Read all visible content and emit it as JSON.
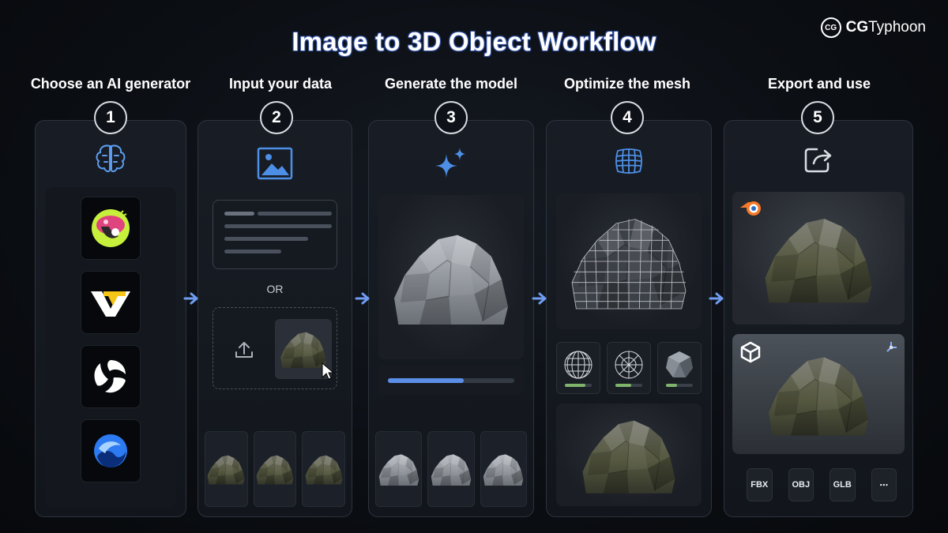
{
  "title": "Image to 3D Object Workflow",
  "brand": {
    "logo": "CG",
    "name_bold": "CG",
    "name_rest": "Typhoon"
  },
  "steps": [
    {
      "number": "1",
      "title": "Choose an AI generator"
    },
    {
      "number": "2",
      "title": "Input your data"
    },
    {
      "number": "3",
      "title": "Generate the model"
    },
    {
      "number": "4",
      "title": "Optimize the mesh"
    },
    {
      "number": "5",
      "title": "Export and use"
    }
  ],
  "col1": {
    "icon": "brain-icon",
    "generators": [
      "mushroom-logo-icon",
      "vt-logo-icon",
      "swirl-logo-icon",
      "blue-wave-logo-icon"
    ]
  },
  "col2": {
    "icon": "image-icon",
    "or_label": "OR",
    "upload_icon": "upload-icon",
    "cursor_icon": "cursor-icon"
  },
  "col3": {
    "icon": "sparkle-icon",
    "progress": 0.6
  },
  "col4": {
    "icon": "mesh-grid-icon",
    "lods": [
      {
        "icon": "wire-sphere-high-icon",
        "level": 0.75
      },
      {
        "icon": "wire-sphere-mid-icon",
        "level": 0.6
      },
      {
        "icon": "lowpoly-sphere-icon",
        "level": 0.4
      }
    ]
  },
  "col5": {
    "icon": "share-icon",
    "apps": [
      "blender-icon",
      "unity-icon"
    ],
    "formats": [
      "FBX",
      "OBJ",
      "GLB",
      "⋯"
    ]
  },
  "colors": {
    "accent_blue": "#5b8ee6",
    "lod_green": "#7fb56a",
    "badge_border": "#d9dde4"
  }
}
